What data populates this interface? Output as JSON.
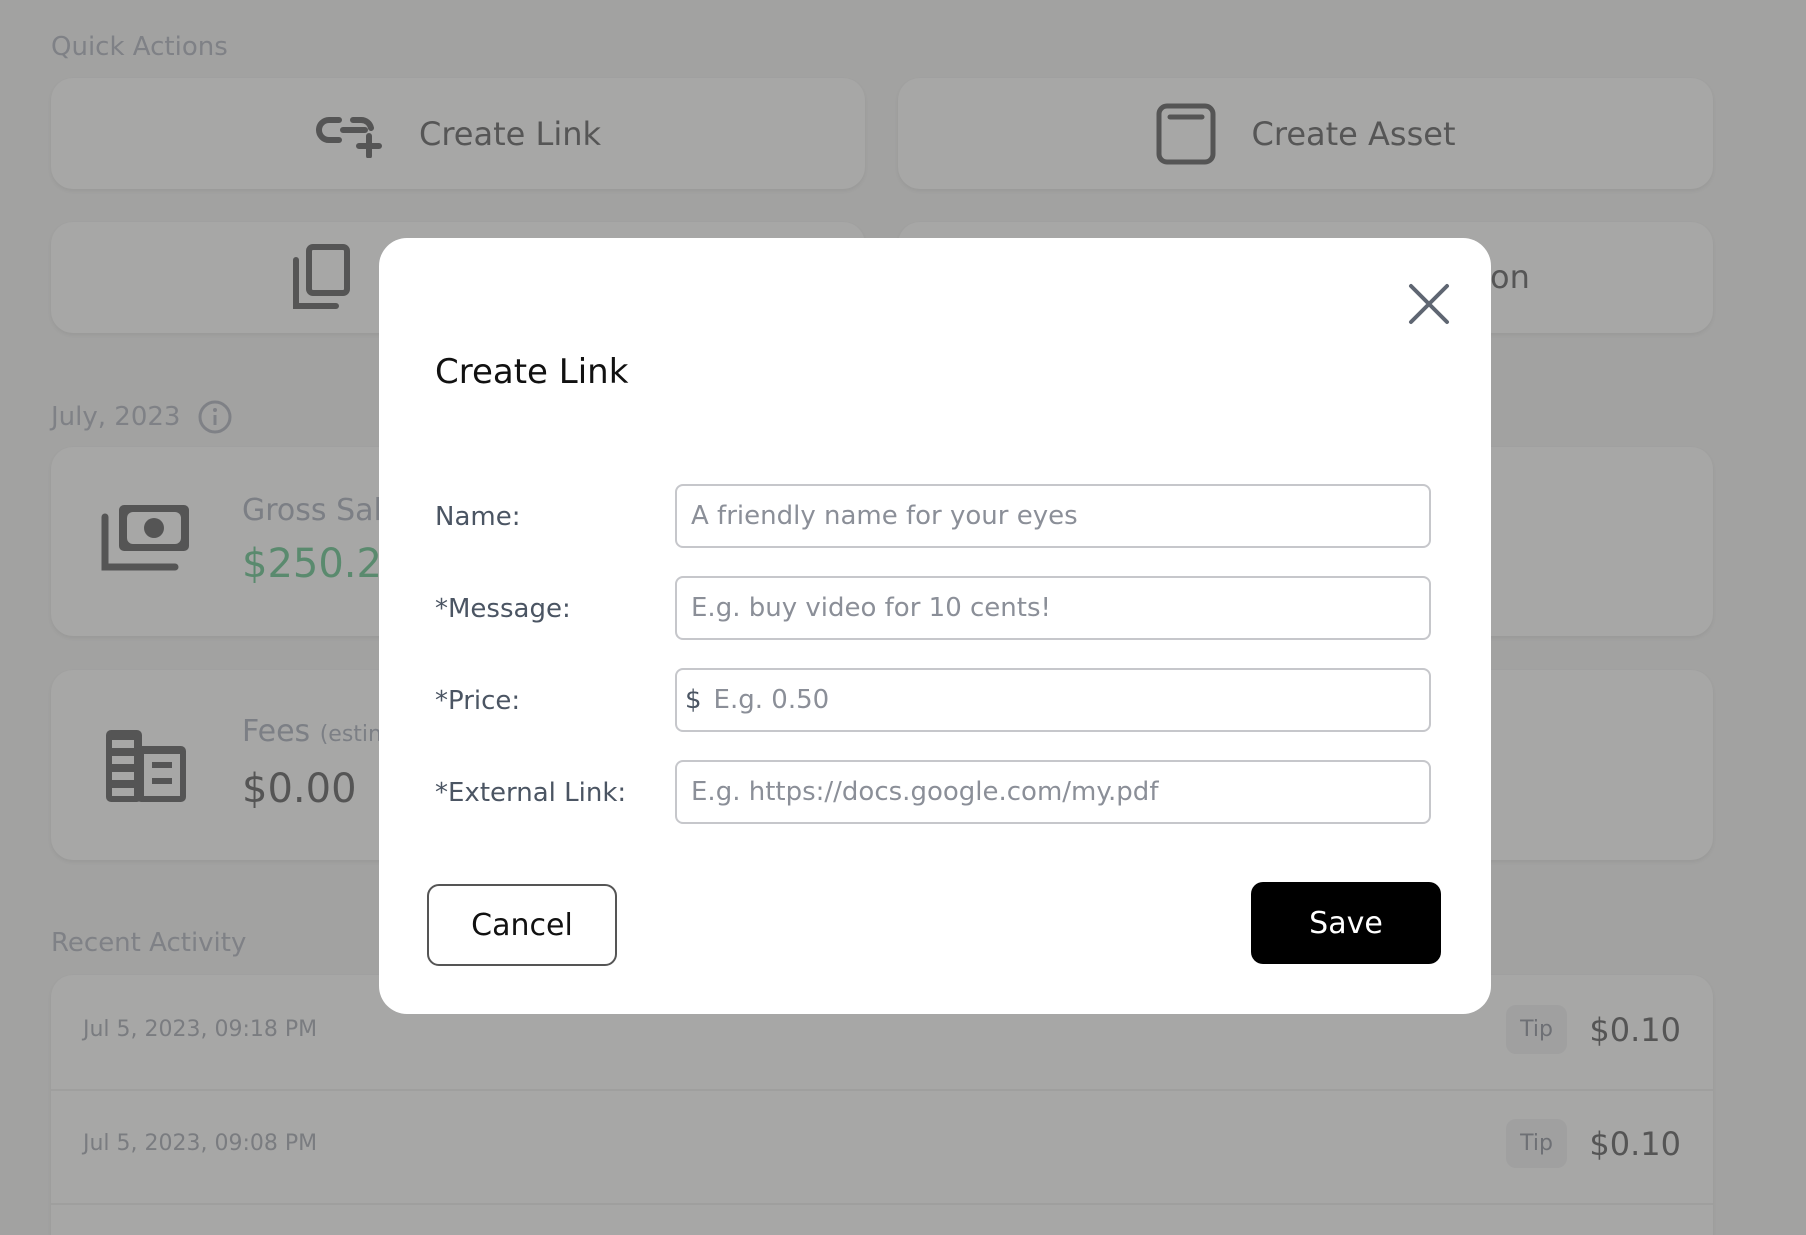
{
  "quick_actions": {
    "heading": "Quick Actions",
    "items": [
      {
        "label": "Create Link",
        "icon": "link-plus-icon"
      },
      {
        "label": "Create Asset",
        "icon": "asset-icon"
      },
      {
        "label": "",
        "icon": "copy-icon"
      },
      {
        "label": "on",
        "icon": ""
      }
    ]
  },
  "period": {
    "heading": "July, 2023",
    "info_icon": "info-icon"
  },
  "stats": {
    "gross": {
      "label": "Gross Sal",
      "value": "$250.2",
      "value_color": "#5a8a6e",
      "icon": "money-icon"
    },
    "fees": {
      "label": "Fees",
      "sublabel": "(estin",
      "value": "$0.00",
      "icon": "ledger-icon"
    }
  },
  "recent_activity": {
    "heading": "Recent Activity",
    "rows": [
      {
        "date": "Jul 5, 2023, 09:18 PM",
        "type": "Tip",
        "amount": "$0.10"
      },
      {
        "date": "Jul 5, 2023, 09:08 PM",
        "type": "Tip",
        "amount": "$0.10"
      }
    ]
  },
  "modal": {
    "title": "Create Link",
    "close_icon": "close-icon",
    "fields": [
      {
        "label": "Name:",
        "placeholder": "A friendly name for your eyes",
        "value": ""
      },
      {
        "label": "*Message:",
        "placeholder": "E.g. buy video for 10 cents!",
        "value": ""
      },
      {
        "label": "*Price:",
        "prefix": "$",
        "placeholder": "E.g. 0.50",
        "value": ""
      },
      {
        "label": "*External Link:",
        "placeholder": "E.g. https://docs.google.com/my.pdf",
        "value": ""
      }
    ],
    "cancel_label": "Cancel",
    "save_label": "Save"
  }
}
